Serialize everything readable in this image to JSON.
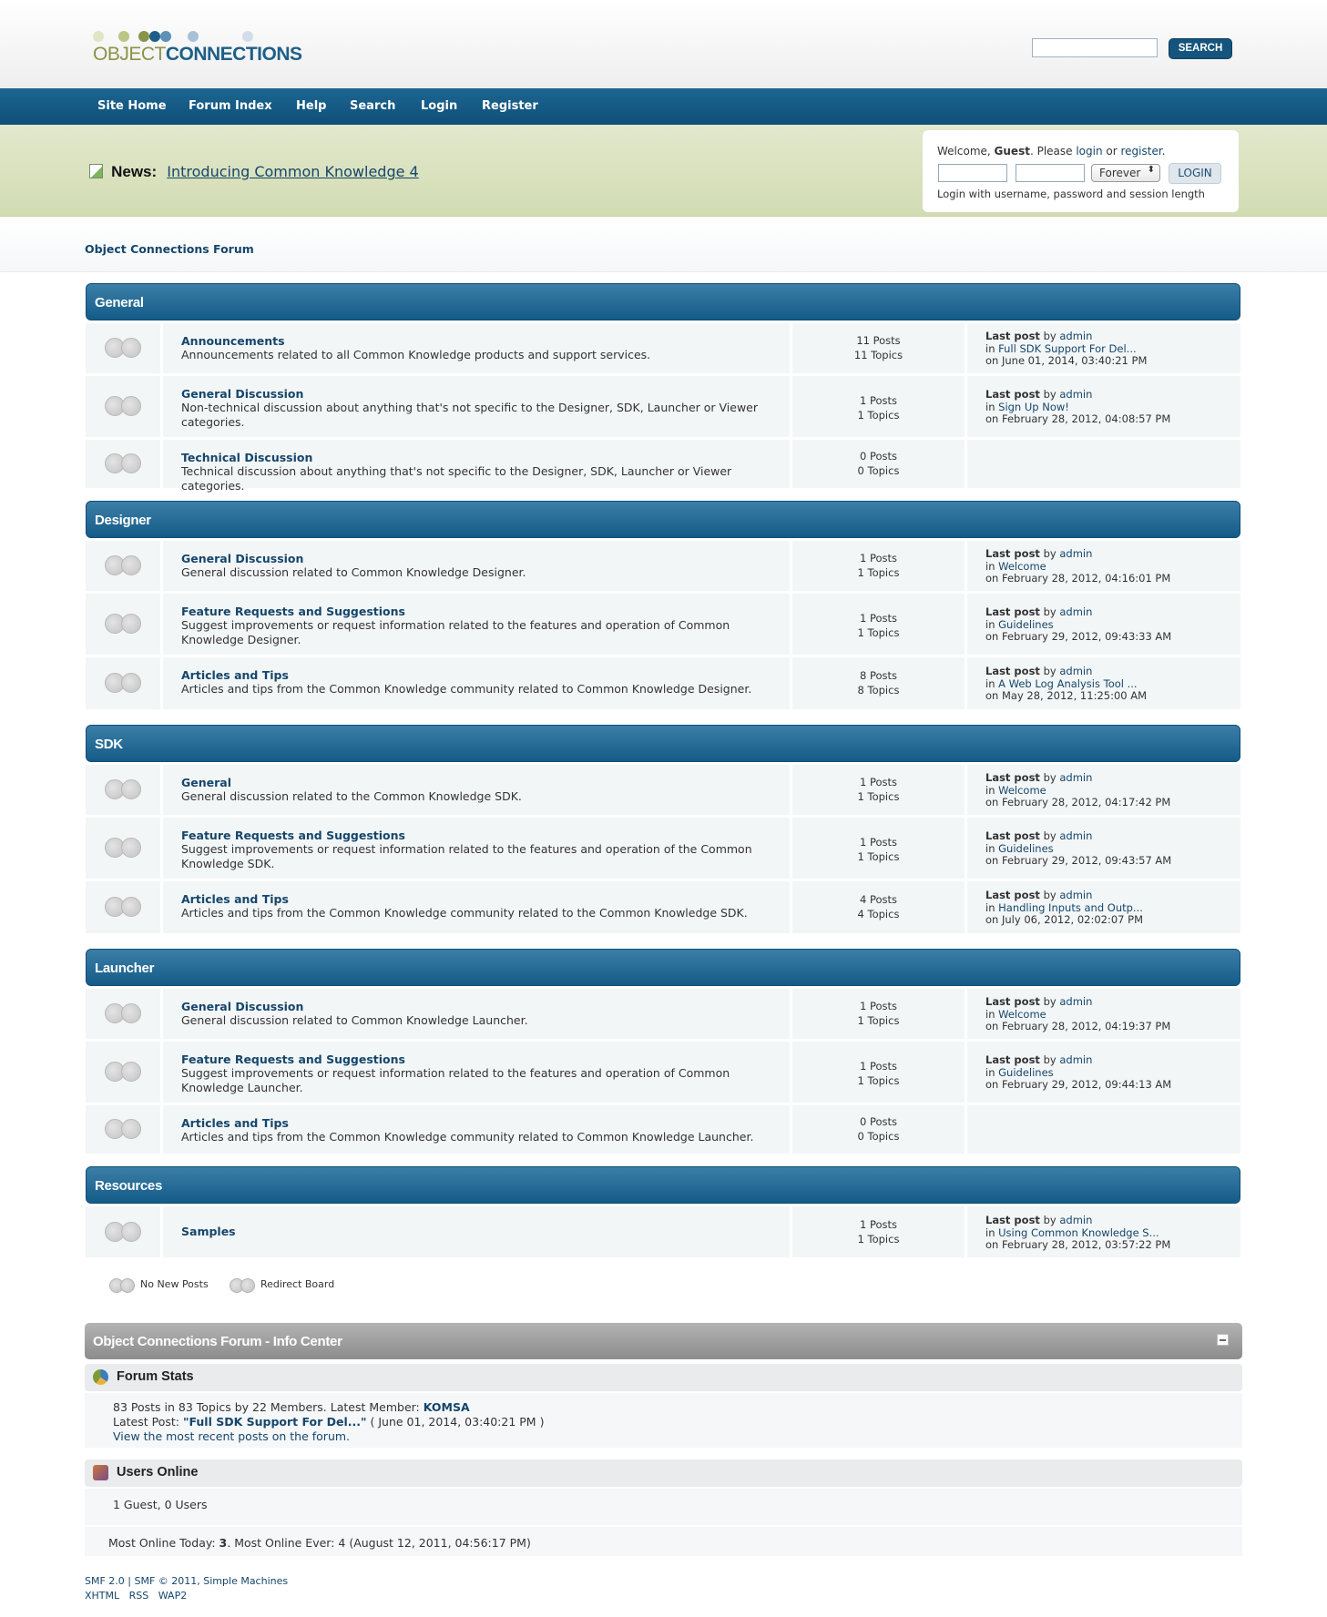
{
  "header": {
    "logo_part1": "OBJECT",
    "logo_part2": "CONNECTIONS",
    "search_button": "SEARCH",
    "search_placeholder": ""
  },
  "nav": [
    "Site Home",
    "Forum Index",
    "Help",
    "Search",
    "Login",
    "Register"
  ],
  "news": {
    "label": "News:",
    "link": "Introducing Common Knowledge 4"
  },
  "login": {
    "welcome_pre": "Welcome, ",
    "guest": "Guest",
    "welcome_mid": ". Please ",
    "login_link": "login",
    "or": " or ",
    "register_link": "register",
    "end": ".",
    "session_value": "Forever",
    "button": "LOGIN",
    "hint": "Login with username, password and session length"
  },
  "breadcrumb": "Object Connections Forum",
  "categories": [
    {
      "title": "General",
      "boards": [
        {
          "name": "Announcements",
          "desc": "Announcements related to all Common Knowledge products and support services.",
          "posts": "11 Posts",
          "topics": "11 Topics",
          "last_by": "admin",
          "last_in": "Full SDK Support For Del...",
          "last_on": "on June 01, 2014, 03:40:21 PM"
        },
        {
          "name": "General Discussion",
          "desc": "Non-technical discussion about anything that's not specific to the Designer, SDK, Launcher or Viewer categories.",
          "posts": "1 Posts",
          "topics": "1 Topics",
          "last_by": "admin",
          "last_in": "Sign Up Now!",
          "last_on": "on February 28, 2012, 04:08:57 PM"
        },
        {
          "name": "Technical Discussion",
          "desc": "Technical discussion about anything that's not specific to the Designer, SDK, Launcher or Viewer categories.",
          "posts": "0 Posts",
          "topics": "0 Topics",
          "last_by": "",
          "last_in": "",
          "last_on": ""
        }
      ]
    },
    {
      "title": "Designer",
      "boards": [
        {
          "name": "General Discussion",
          "desc": "General discussion related to Common Knowledge Designer.",
          "posts": "1 Posts",
          "topics": "1 Topics",
          "last_by": "admin",
          "last_in": "Welcome",
          "last_on": "on February 28, 2012, 04:16:01 PM"
        },
        {
          "name": "Feature Requests and Suggestions",
          "desc": "Suggest improvements or request information related to the features and operation of Common Knowledge Designer.",
          "posts": "1 Posts",
          "topics": "1 Topics",
          "last_by": "admin",
          "last_in": "Guidelines",
          "last_on": "on February 29, 2012, 09:43:33 AM"
        },
        {
          "name": "Articles and Tips",
          "desc": "Articles and tips from the Common Knowledge community related to Common Knowledge Designer.",
          "posts": "8 Posts",
          "topics": "8 Topics",
          "last_by": "admin",
          "last_in": "A Web Log Analysis Tool ...",
          "last_on": "on May 28, 2012, 11:25:00 AM"
        }
      ]
    },
    {
      "title": "SDK",
      "boards": [
        {
          "name": "General",
          "desc": "General discussion related to the Common Knowledge SDK.",
          "posts": "1 Posts",
          "topics": "1 Topics",
          "last_by": "admin",
          "last_in": "Welcome",
          "last_on": "on February 28, 2012, 04:17:42 PM"
        },
        {
          "name": "Feature Requests and Suggestions",
          "desc": "Suggest improvements or request information related to the features and operation of the Common Knowledge SDK.",
          "posts": "1 Posts",
          "topics": "1 Topics",
          "last_by": "admin",
          "last_in": "Guidelines",
          "last_on": "on February 29, 2012, 09:43:57 AM"
        },
        {
          "name": "Articles and Tips",
          "desc": "Articles and tips from the Common Knowledge community related to the Common Knowledge SDK.",
          "posts": "4 Posts",
          "topics": "4 Topics",
          "last_by": "admin",
          "last_in": "Handling Inputs and Outp...",
          "last_on": "on July 06, 2012, 02:02:07 PM"
        }
      ]
    },
    {
      "title": "Launcher",
      "boards": [
        {
          "name": "General Discussion",
          "desc": "General discussion related to Common Knowledge Launcher.",
          "posts": "1 Posts",
          "topics": "1 Topics",
          "last_by": "admin",
          "last_in": "Welcome",
          "last_on": "on February 28, 2012, 04:19:37 PM"
        },
        {
          "name": "Feature Requests and Suggestions",
          "desc": "Suggest improvements or request information related to the features and operation of Common Knowledge Launcher.",
          "posts": "1 Posts",
          "topics": "1 Topics",
          "last_by": "admin",
          "last_in": "Guidelines",
          "last_on": "on February 29, 2012, 09:44:13 AM"
        },
        {
          "name": "Articles and Tips",
          "desc": "Articles and tips from the Common Knowledge community related to Common Knowledge Launcher.",
          "posts": "0 Posts",
          "topics": "0 Topics",
          "last_by": "",
          "last_in": "",
          "last_on": ""
        }
      ]
    },
    {
      "title": "Resources",
      "boards": [
        {
          "name": "Samples",
          "desc": "",
          "posts": "1 Posts",
          "topics": "1 Topics",
          "last_by": "admin",
          "last_in": "Using Common Knowledge S...",
          "last_on": "on February 28, 2012, 03:57:22 PM"
        }
      ]
    }
  ],
  "labels": {
    "last_post": "Last post",
    "by": " by ",
    "in": "in "
  },
  "legend": {
    "no_new": "No New Posts",
    "redirect": "Redirect Board"
  },
  "info_center": {
    "title": "Object Connections Forum - Info Center",
    "stats_title": "Forum Stats",
    "stats_line1_pre": "83 Posts in 83 Topics by 22 Members. Latest Member: ",
    "latest_member": "KOMSA",
    "stats_line2_pre": "Latest Post: ",
    "latest_post": "\"Full SDK Support For Del...\"",
    "stats_line2_post": " ( June 01, 2014, 03:40:21 PM )",
    "recent_link": "View the most recent posts on the forum.",
    "users_title": "Users Online",
    "users_line": "1 Guest, 0 Users",
    "most_online_pre": "Most Online Today: ",
    "most_online_today": "3",
    "most_online_post": ". Most Online Ever: 4 (August 12, 2011, 04:56:17 PM)"
  },
  "footer": {
    "line1": "SMF 2.0 | SMF © 2011, Simple Machines",
    "links": [
      "XHTML",
      "RSS",
      "WAP2"
    ]
  },
  "colors": {
    "nav": "#155b88",
    "band": "#d8e0bd",
    "link": "#15466b",
    "dots": [
      "#dfe6c4",
      "#b9c685",
      "#8a9347",
      "#1d5f88",
      "#5d91b7",
      "#a9c1d8",
      "#cfdeea"
    ]
  }
}
